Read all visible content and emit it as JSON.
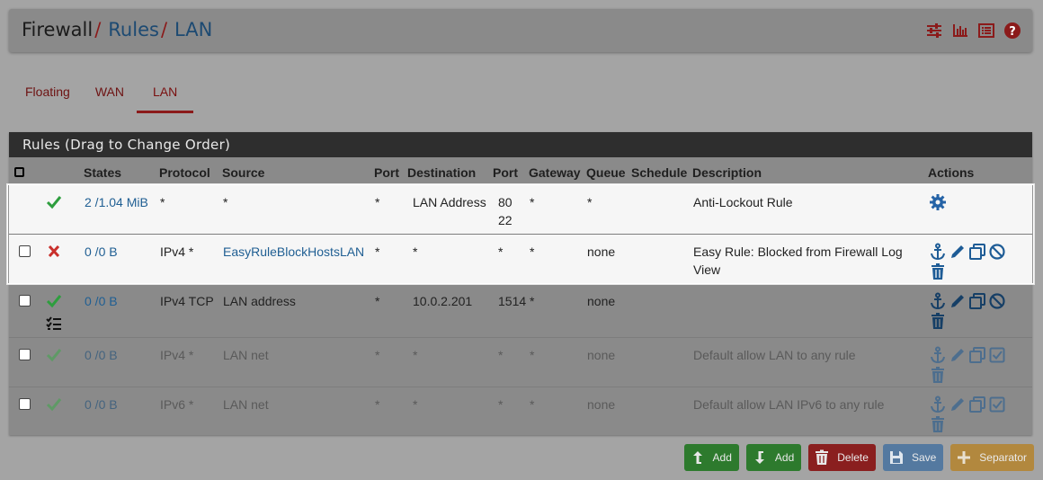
{
  "breadcrumb": {
    "root": "Firewall",
    "sep1": "/",
    "rules": "Rules",
    "sep2": "/",
    "iface": "LAN"
  },
  "header_icons": [
    "sliders-icon",
    "bar-chart-icon",
    "list-icon",
    "help-icon"
  ],
  "tabs": [
    {
      "label": "Floating"
    },
    {
      "label": "WAN"
    },
    {
      "label": "LAN",
      "active": true
    }
  ],
  "panel": {
    "title": "Rules (Drag to Change Order)"
  },
  "columns": {
    "states": "States",
    "protocol": "Protocol",
    "source": "Source",
    "port": "Port",
    "destination": "Destination",
    "dport": "Port",
    "gateway": "Gateway",
    "queue": "Queue",
    "schedule": "Schedule",
    "description": "Description",
    "actions": "Actions"
  },
  "rows": [
    {
      "status": "pass",
      "states": "2 /1.04 MiB",
      "protocol": "*",
      "source": "*",
      "port": "*",
      "destination": "LAN Address",
      "dport": "80 22",
      "gateway": "*",
      "queue": "*",
      "schedule": "",
      "description": "Anti-Lockout Rule"
    },
    {
      "status": "block",
      "states": "0 /0 B",
      "protocol": "IPv4 *",
      "source": "EasyRuleBlockHostsLAN",
      "port": "*",
      "destination": "*",
      "dport": "*",
      "gateway": "*",
      "queue": "none",
      "schedule": "",
      "description": "Easy Rule: Blocked from Firewall Log View"
    },
    {
      "status": "pass",
      "states": "0 /0 B",
      "protocol": "IPv4 TCP",
      "source": "LAN address",
      "port": "*",
      "destination": "10.0.2.201",
      "dport": "1514",
      "gateway": "*",
      "queue": "none",
      "schedule": "",
      "description": ""
    },
    {
      "status": "pass-disabled",
      "states": "0 /0 B",
      "protocol": "IPv4 *",
      "source": "LAN net",
      "port": "*",
      "destination": "*",
      "dport": "*",
      "gateway": "*",
      "queue": "none",
      "schedule": "",
      "description": "Default allow LAN to any rule"
    },
    {
      "status": "pass-disabled",
      "states": "0 /0 B",
      "protocol": "IPv6 *",
      "source": "LAN net",
      "port": "*",
      "destination": "*",
      "dport": "*",
      "gateway": "*",
      "queue": "none",
      "schedule": "",
      "description": "Default allow LAN IPv6 to any rule"
    }
  ],
  "buttons": {
    "add_top": "Add",
    "add_bottom": "Add",
    "delete": "Delete",
    "save": "Save",
    "separator": "Separator"
  },
  "colors": {
    "accent_red": "#8b1a1a",
    "link_blue": "#205f93",
    "pass_green": "#2e9e3e",
    "block_red": "#c9302c"
  }
}
